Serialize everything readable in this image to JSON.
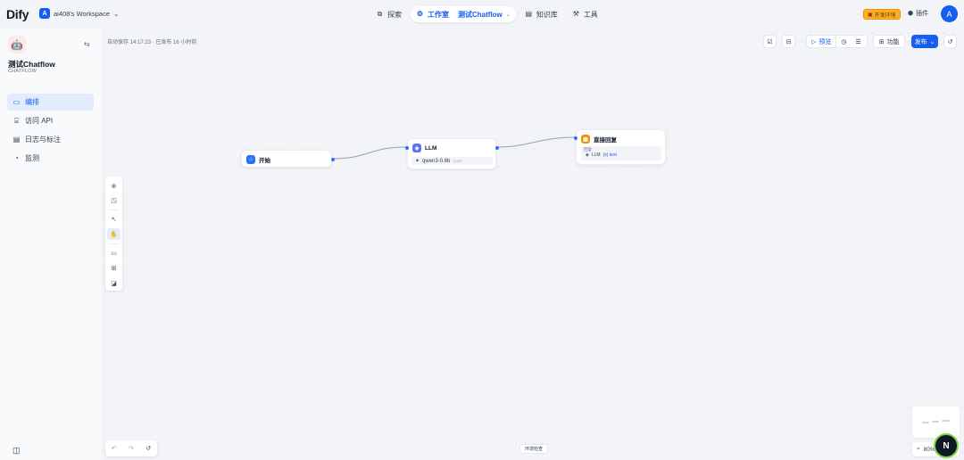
{
  "header": {
    "logo_text": "Dify",
    "workspace_initial": "A",
    "workspace_name": "ai408's Workspace",
    "nav": [
      {
        "label": "探索",
        "icon": "explore-icon"
      },
      {
        "label": "工作室",
        "icon": "studio-icon",
        "sub": "测试Chatflow"
      },
      {
        "label": "知识库",
        "icon": "knowledge-icon"
      },
      {
        "label": "工具",
        "icon": "tools-icon"
      }
    ],
    "env_badge": "开发环境",
    "plugin_label": "插件",
    "user_initial": "A"
  },
  "sidebar": {
    "app_name": "测试Chatflow",
    "app_type": "CHATFLOW",
    "items": [
      {
        "label": "编排",
        "icon": "orchestrate-icon",
        "active": true
      },
      {
        "label": "访问 API",
        "icon": "api-icon",
        "active": false
      },
      {
        "label": "日志与标注",
        "icon": "logs-icon",
        "active": false
      },
      {
        "label": "监测",
        "icon": "monitor-icon",
        "active": false
      }
    ]
  },
  "canvas": {
    "autosave_text": "自动保存 14:17:23 · 已发布 16 小时前",
    "toolbar": {
      "preview_label": "预览",
      "features_label": "功能",
      "publish_label": "发布"
    },
    "nodes": {
      "start": {
        "title": "开始"
      },
      "llm": {
        "title": "LLM",
        "model": "qwen3-0.6b",
        "mode": "CHAT"
      },
      "answer": {
        "title": "直接回复",
        "field_label": "回复",
        "var_source": "LLM",
        "var_name": "{x} text"
      }
    },
    "env_button": "环境检查",
    "zoom_level": "80%"
  },
  "colors": {
    "accent": "#155eef",
    "start_node": "#2970ff",
    "llm_node": "#6172f3",
    "answer_node": "#f79009"
  }
}
